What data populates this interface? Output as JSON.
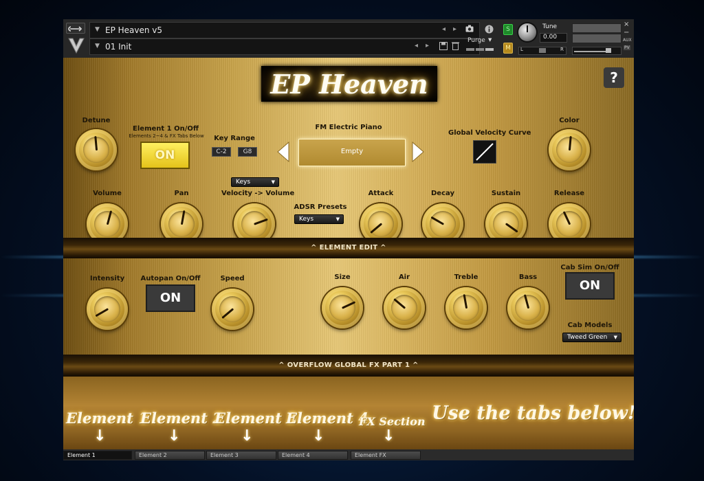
{
  "header": {
    "instrument_name": "EP Heaven v5",
    "snapshot_name": "01 Init",
    "purge_label": "Purge",
    "tune_label": "Tune",
    "tune_value": "0.00",
    "solo_label": "S",
    "mute_label": "M",
    "aux_label": "AUX",
    "pv_label": "PV",
    "left_label": "L",
    "right_label": "R",
    "close_glyph": "×",
    "minimize_glyph": "−",
    "icons": [
      "wrench-icon",
      "logo-icon",
      "camera-icon",
      "info-icon",
      "save-icon",
      "trash-icon"
    ]
  },
  "title": {
    "logo_text": "EP Heaven",
    "help_label": "?"
  },
  "main": {
    "detune_label": "Detune",
    "element1_label": "Element 1 On/Off",
    "element1_sub": "Elements 2~4 & FX Tabs Below",
    "element1_button": "ON",
    "key_range_label": "Key Range",
    "key_low": "C-2",
    "key_high": "G8",
    "preset_category": "FM Electric Piano",
    "preset_value": "Empty",
    "global_velocity_label": "Global Velocity Curve",
    "color_label": "Color",
    "volume_label": "Volume",
    "pan_label": "Pan",
    "keys_dropdown": "Keys",
    "velocity_volume_label": "Velocity -> Volume",
    "adsr_presets_label": "ADSR Presets",
    "adsr_dropdown": "Keys",
    "attack_label": "Attack",
    "decay_label": "Decay",
    "sustain_label": "Sustain",
    "release_label": "Release"
  },
  "bars": {
    "element_edit": "^ ELEMENT EDIT ^",
    "overflow_fx": "^ OVERFLOW GLOBAL FX PART 1 ^"
  },
  "fx": {
    "intensity_label": "Intensity",
    "autopan_label": "Autopan On/Off",
    "autopan_button": "ON",
    "speed_label": "Speed",
    "size_label": "Size",
    "air_label": "Air",
    "treble_label": "Treble",
    "bass_label": "Bass",
    "cabsim_label": "Cab Sim On/Off",
    "cabsim_button": "ON",
    "cab_models_label": "Cab Models",
    "cab_model_value": "Tweed Green"
  },
  "hint": {
    "element1": "Element 1",
    "element2": "Element 2",
    "element3": "Element 3",
    "element4": "Element 4",
    "fx_section": "FX Section",
    "use_tabs": "Use the tabs below!",
    "arrow_glyph": "↓"
  },
  "tabs": [
    {
      "label": "Element 1",
      "active": true
    },
    {
      "label": "Element 2",
      "active": false
    },
    {
      "label": "Element 3",
      "active": false
    },
    {
      "label": "Element 4",
      "active": false
    },
    {
      "label": "Element FX",
      "active": false
    }
  ],
  "colors": {
    "gold_light": "#e8c978",
    "gold_dark": "#6d4e12",
    "on_yellow": "#f0d430",
    "background": "#041024"
  }
}
